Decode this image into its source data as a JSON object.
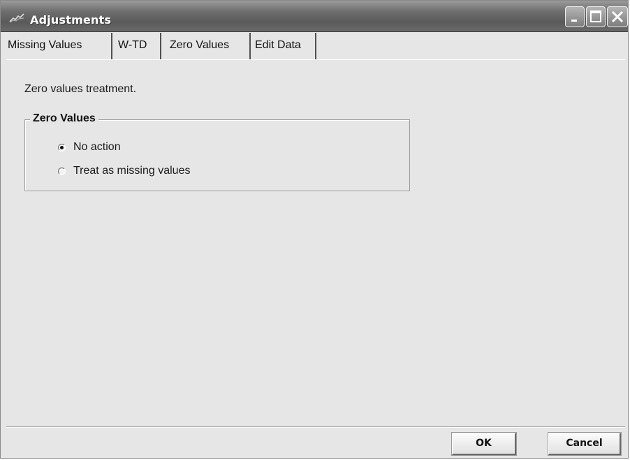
{
  "window": {
    "title": "Adjustments",
    "title_icon": "chart-line-icon",
    "controls": [
      "minimize-icon",
      "maximize-icon",
      "close-icon"
    ]
  },
  "tabs": [
    {
      "label": "Missing Values",
      "active": false
    },
    {
      "label": "W-TD",
      "active": false
    },
    {
      "label": "Zero Values",
      "active": true
    },
    {
      "label": "Edit Data",
      "active": false
    }
  ],
  "panel": {
    "description": "Zero values treatment.",
    "group": {
      "title": "Zero Values",
      "options": [
        {
          "label": "No action",
          "checked": true
        },
        {
          "label": "Treat as missing values",
          "checked": false
        }
      ]
    }
  },
  "buttons": {
    "ok": "OK",
    "cancel": "Cancel"
  }
}
